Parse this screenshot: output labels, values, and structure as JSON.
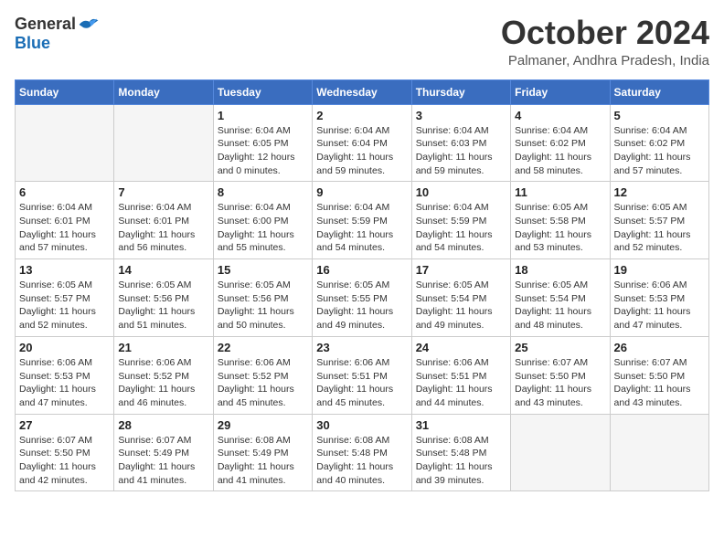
{
  "header": {
    "logo": {
      "general": "General",
      "blue": "Blue"
    },
    "title": "October 2024",
    "location": "Palmaner, Andhra Pradesh, India"
  },
  "weekdays": [
    "Sunday",
    "Monday",
    "Tuesday",
    "Wednesday",
    "Thursday",
    "Friday",
    "Saturday"
  ],
  "weeks": [
    [
      {
        "day": "",
        "info": ""
      },
      {
        "day": "",
        "info": ""
      },
      {
        "day": "1",
        "info": "Sunrise: 6:04 AM\nSunset: 6:05 PM\nDaylight: 12 hours\nand 0 minutes."
      },
      {
        "day": "2",
        "info": "Sunrise: 6:04 AM\nSunset: 6:04 PM\nDaylight: 11 hours\nand 59 minutes."
      },
      {
        "day": "3",
        "info": "Sunrise: 6:04 AM\nSunset: 6:03 PM\nDaylight: 11 hours\nand 59 minutes."
      },
      {
        "day": "4",
        "info": "Sunrise: 6:04 AM\nSunset: 6:02 PM\nDaylight: 11 hours\nand 58 minutes."
      },
      {
        "day": "5",
        "info": "Sunrise: 6:04 AM\nSunset: 6:02 PM\nDaylight: 11 hours\nand 57 minutes."
      }
    ],
    [
      {
        "day": "6",
        "info": "Sunrise: 6:04 AM\nSunset: 6:01 PM\nDaylight: 11 hours\nand 57 minutes."
      },
      {
        "day": "7",
        "info": "Sunrise: 6:04 AM\nSunset: 6:01 PM\nDaylight: 11 hours\nand 56 minutes."
      },
      {
        "day": "8",
        "info": "Sunrise: 6:04 AM\nSunset: 6:00 PM\nDaylight: 11 hours\nand 55 minutes."
      },
      {
        "day": "9",
        "info": "Sunrise: 6:04 AM\nSunset: 5:59 PM\nDaylight: 11 hours\nand 54 minutes."
      },
      {
        "day": "10",
        "info": "Sunrise: 6:04 AM\nSunset: 5:59 PM\nDaylight: 11 hours\nand 54 minutes."
      },
      {
        "day": "11",
        "info": "Sunrise: 6:05 AM\nSunset: 5:58 PM\nDaylight: 11 hours\nand 53 minutes."
      },
      {
        "day": "12",
        "info": "Sunrise: 6:05 AM\nSunset: 5:57 PM\nDaylight: 11 hours\nand 52 minutes."
      }
    ],
    [
      {
        "day": "13",
        "info": "Sunrise: 6:05 AM\nSunset: 5:57 PM\nDaylight: 11 hours\nand 52 minutes."
      },
      {
        "day": "14",
        "info": "Sunrise: 6:05 AM\nSunset: 5:56 PM\nDaylight: 11 hours\nand 51 minutes."
      },
      {
        "day": "15",
        "info": "Sunrise: 6:05 AM\nSunset: 5:56 PM\nDaylight: 11 hours\nand 50 minutes."
      },
      {
        "day": "16",
        "info": "Sunrise: 6:05 AM\nSunset: 5:55 PM\nDaylight: 11 hours\nand 49 minutes."
      },
      {
        "day": "17",
        "info": "Sunrise: 6:05 AM\nSunset: 5:54 PM\nDaylight: 11 hours\nand 49 minutes."
      },
      {
        "day": "18",
        "info": "Sunrise: 6:05 AM\nSunset: 5:54 PM\nDaylight: 11 hours\nand 48 minutes."
      },
      {
        "day": "19",
        "info": "Sunrise: 6:06 AM\nSunset: 5:53 PM\nDaylight: 11 hours\nand 47 minutes."
      }
    ],
    [
      {
        "day": "20",
        "info": "Sunrise: 6:06 AM\nSunset: 5:53 PM\nDaylight: 11 hours\nand 47 minutes."
      },
      {
        "day": "21",
        "info": "Sunrise: 6:06 AM\nSunset: 5:52 PM\nDaylight: 11 hours\nand 46 minutes."
      },
      {
        "day": "22",
        "info": "Sunrise: 6:06 AM\nSunset: 5:52 PM\nDaylight: 11 hours\nand 45 minutes."
      },
      {
        "day": "23",
        "info": "Sunrise: 6:06 AM\nSunset: 5:51 PM\nDaylight: 11 hours\nand 45 minutes."
      },
      {
        "day": "24",
        "info": "Sunrise: 6:06 AM\nSunset: 5:51 PM\nDaylight: 11 hours\nand 44 minutes."
      },
      {
        "day": "25",
        "info": "Sunrise: 6:07 AM\nSunset: 5:50 PM\nDaylight: 11 hours\nand 43 minutes."
      },
      {
        "day": "26",
        "info": "Sunrise: 6:07 AM\nSunset: 5:50 PM\nDaylight: 11 hours\nand 43 minutes."
      }
    ],
    [
      {
        "day": "27",
        "info": "Sunrise: 6:07 AM\nSunset: 5:50 PM\nDaylight: 11 hours\nand 42 minutes."
      },
      {
        "day": "28",
        "info": "Sunrise: 6:07 AM\nSunset: 5:49 PM\nDaylight: 11 hours\nand 41 minutes."
      },
      {
        "day": "29",
        "info": "Sunrise: 6:08 AM\nSunset: 5:49 PM\nDaylight: 11 hours\nand 41 minutes."
      },
      {
        "day": "30",
        "info": "Sunrise: 6:08 AM\nSunset: 5:48 PM\nDaylight: 11 hours\nand 40 minutes."
      },
      {
        "day": "31",
        "info": "Sunrise: 6:08 AM\nSunset: 5:48 PM\nDaylight: 11 hours\nand 39 minutes."
      },
      {
        "day": "",
        "info": ""
      },
      {
        "day": "",
        "info": ""
      }
    ]
  ]
}
